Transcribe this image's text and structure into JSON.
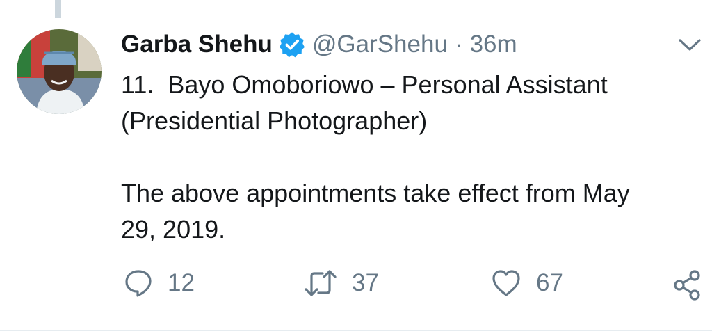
{
  "tweet": {
    "author_name": "Garba Shehu",
    "handle": "@GarShehu",
    "separator": "·",
    "time": "36m",
    "text": "11.  Bayo Omoboriowo – Personal Assistant\n(Presidential Photographer)\n\nThe above appointments take effect from May\n29, 2019."
  },
  "actions": {
    "reply_count": "12",
    "retweet_count": "37",
    "like_count": "67"
  },
  "colors": {
    "verified_badge": "#1da1f2",
    "secondary_text": "#657786",
    "primary_text": "#14171a"
  },
  "icons": {
    "verified": "verified-badge-icon",
    "menu": "chevron-down-icon",
    "reply": "reply-icon",
    "retweet": "retweet-icon",
    "like": "heart-icon",
    "share": "share-icon"
  }
}
